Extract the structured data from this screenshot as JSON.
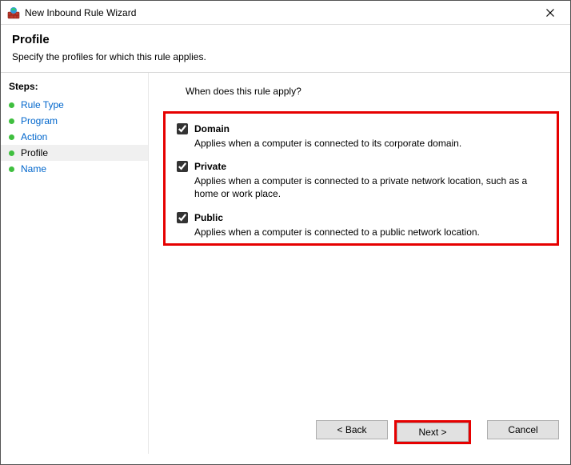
{
  "window": {
    "title": "New Inbound Rule Wizard"
  },
  "header": {
    "title": "Profile",
    "subtitle": "Specify the profiles for which this rule applies."
  },
  "sidebar": {
    "heading": "Steps:",
    "items": [
      {
        "label": "Rule Type",
        "active": false
      },
      {
        "label": "Program",
        "active": false
      },
      {
        "label": "Action",
        "active": false
      },
      {
        "label": "Profile",
        "active": true
      },
      {
        "label": "Name",
        "active": false
      }
    ]
  },
  "main": {
    "question": "When does this rule apply?",
    "options": [
      {
        "name": "Domain",
        "desc": "Applies when a computer is connected to its corporate domain.",
        "checked": true
      },
      {
        "name": "Private",
        "desc": "Applies when a computer is connected to a private network location, such as a home or work place.",
        "checked": true
      },
      {
        "name": "Public",
        "desc": "Applies when a computer is connected to a public network location.",
        "checked": true
      }
    ]
  },
  "buttons": {
    "back": "< Back",
    "next": "Next >",
    "cancel": "Cancel"
  }
}
